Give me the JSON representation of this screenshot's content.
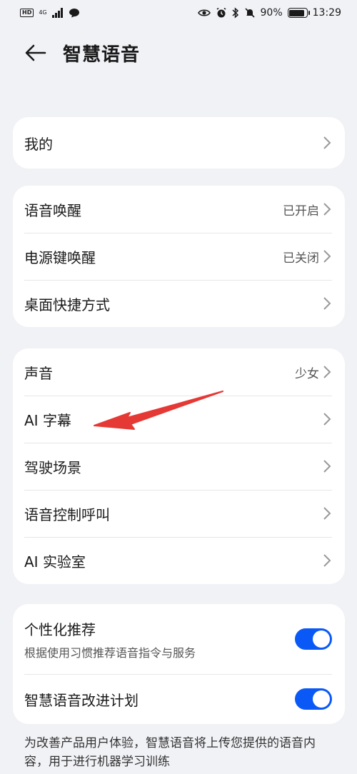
{
  "status_bar": {
    "hd": "HD",
    "network": "4G",
    "battery_text": "90%",
    "battery_level": 0.9,
    "time": "13:29"
  },
  "header": {
    "title": "智慧语音"
  },
  "section1": {
    "items": [
      {
        "label": "我的"
      }
    ]
  },
  "section2": {
    "items": [
      {
        "label": "语音唤醒",
        "value": "已开启"
      },
      {
        "label": "电源键唤醒",
        "value": "已关闭"
      },
      {
        "label": "桌面快捷方式"
      }
    ]
  },
  "section3": {
    "items": [
      {
        "label": "声音",
        "value": "少女"
      },
      {
        "label": "AI 字幕"
      },
      {
        "label": "驾驶场景"
      },
      {
        "label": "语音控制呼叫"
      },
      {
        "label": "AI 实验室"
      }
    ]
  },
  "section4": {
    "items": [
      {
        "label": "个性化推荐",
        "sub": "根据使用习惯推荐语音指令与服务",
        "on": true
      },
      {
        "label": "智慧语音改进计划",
        "on": true
      }
    ]
  },
  "footer": {
    "note": "为改善产品用户体验，智慧语音将上传您提供的语音内容，用于进行机器学习训练"
  },
  "colors": {
    "accent": "#0a59f7",
    "annotation_arrow": "#e53935",
    "background": "#f1f2f6"
  }
}
